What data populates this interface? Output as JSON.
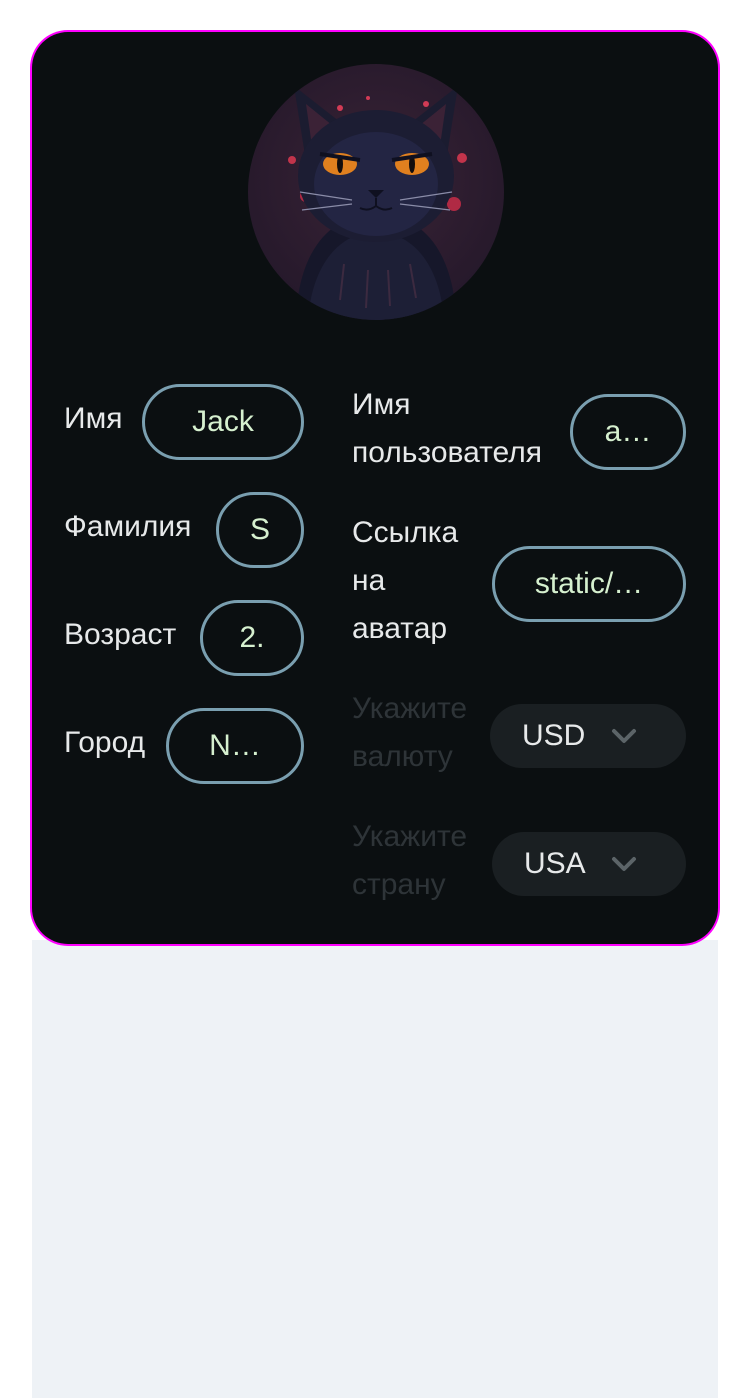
{
  "profile": {
    "avatar_alt": "cat-avatar",
    "first_name_label": "Имя",
    "first_name_value": "Jack",
    "last_name_label": "Фамилия",
    "last_name_value": "S",
    "age_label": "Возраст",
    "age_value": "2.",
    "city_label": "Город",
    "city_value": "N…",
    "username_label": "Имя пользователя",
    "username_value": "a…",
    "avatar_link_label": "Ссылка на аватар",
    "avatar_link_value": "static/…",
    "currency_label": "Укажите валюту",
    "currency_value": "USD",
    "country_label": "Укажите страну",
    "country_value": "USA"
  },
  "colors": {
    "card_bg": "#0b0f11",
    "field_border": "#7a9fb0",
    "field_text": "#d6f0cf",
    "label_text": "#e7e9ea",
    "muted_label": "#2e3438",
    "select_bg": "#1a1f22",
    "page_panel": "#eef2f6",
    "card_outline": "#ff00ff"
  },
  "icons": {
    "select_arrow": "chevron-down-icon"
  }
}
